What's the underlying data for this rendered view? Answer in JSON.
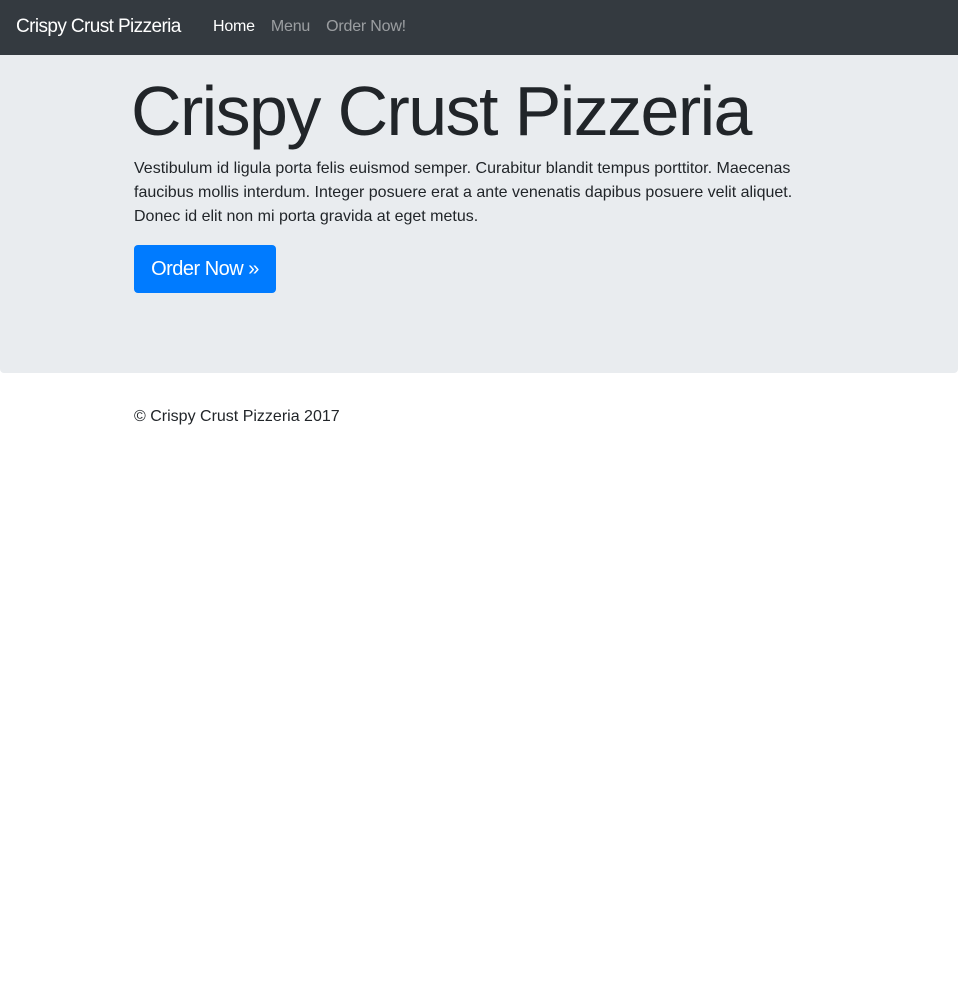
{
  "navbar": {
    "brand": "Crispy Crust Pizzeria",
    "links": [
      {
        "label": "Home",
        "active": true
      },
      {
        "label": "Menu",
        "active": false
      },
      {
        "label": "Order Now!",
        "active": false
      }
    ]
  },
  "hero": {
    "title": "Crispy Crust Pizzeria",
    "lead": "Vestibulum id ligula porta felis euismod semper. Curabitur blandit tempus porttitor. Maecenas faucibus mollis interdum. Integer posuere erat a ante venenatis dapibus posuere velit aliquet. Donec id elit non mi porta gravida at eget metus.",
    "button_label": "Order Now »"
  },
  "footer": {
    "text": "© Crispy Crust Pizzeria 2017"
  },
  "colors": {
    "navbar_bg": "#343a40",
    "hero_bg": "#e9ecef",
    "accent": "#007bff"
  }
}
